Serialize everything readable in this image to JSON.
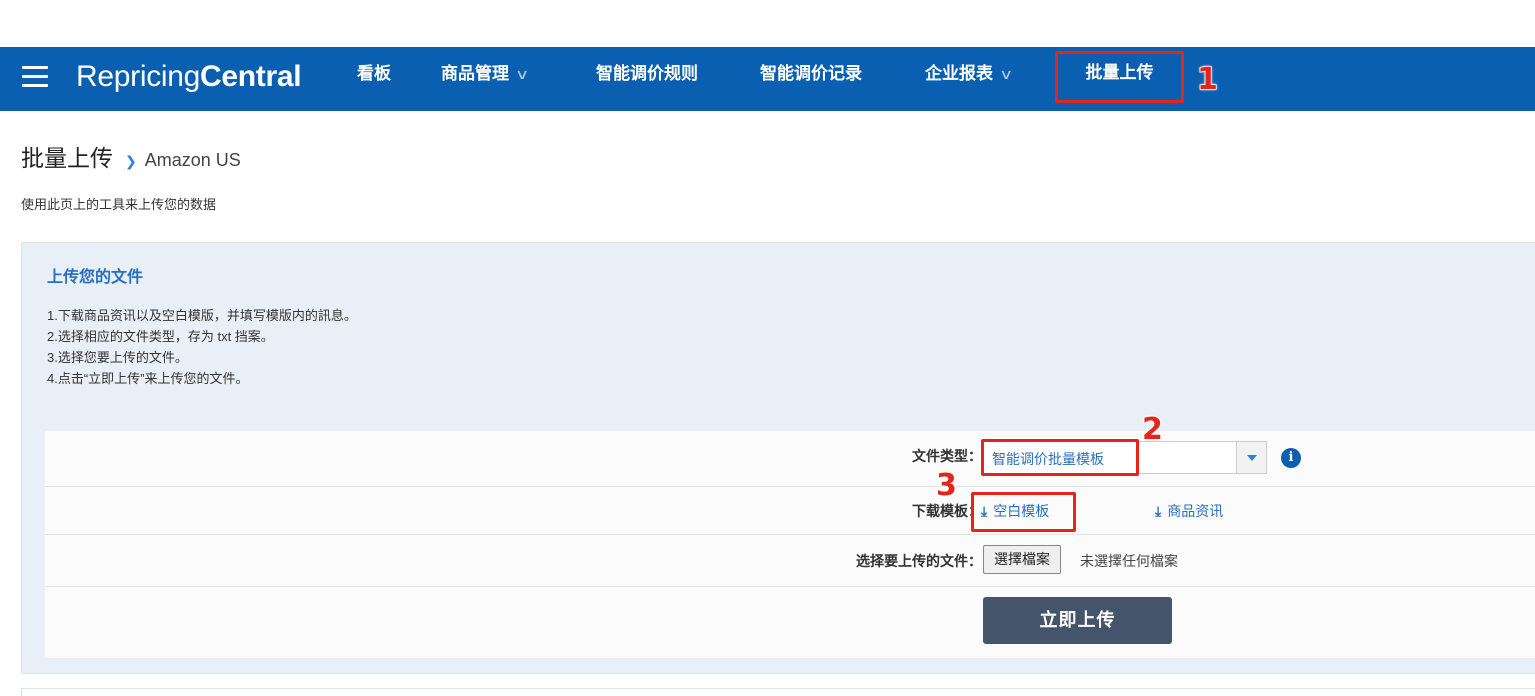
{
  "navbar": {
    "logo_part1": "Repricing",
    "logo_part2": "Central",
    "items": [
      {
        "label": "看板"
      },
      {
        "label": "商品管理",
        "chevron": "chevron-down-icon"
      },
      {
        "label": "智能调价规则"
      },
      {
        "label": "智能调价记录"
      },
      {
        "label": "企业报表",
        "chevron": "chevron-down-icon"
      },
      {
        "label": "批量上传"
      }
    ],
    "chevron_glyph": "∨",
    "color": "#0b5fb0"
  },
  "annotations": {
    "marker1": "1",
    "marker2": "2",
    "marker3": "3",
    "color": "#e5251b"
  },
  "breadcrumb": {
    "title": "批量上传",
    "separator": "❯",
    "sub": "Amazon US"
  },
  "subtitle": "使用此页上的工具来上传您的数据",
  "upload_panel": {
    "title": "上传您的文件",
    "steps": [
      "1.下载商品资讯以及空白模版，并填写模版内的訊息。",
      "2.选择相应的文件类型，存为 txt 挡案。",
      "3.选择您要上传的文件。",
      "4.点击“立即上传”来上传您的文件。"
    ],
    "file_type_label": "文件类型：",
    "file_type_value": "智能调价批量模板",
    "info_glyph": "i",
    "download_label": "下载模板：",
    "download_blank": "空白模板",
    "download_product": "商品资讯",
    "download_glyph": "⤓",
    "choose_file_label": "选择要上传的文件：",
    "choose_file_button": "選擇檔案",
    "no_file_text": "未選擇任何檔案",
    "upload_button": "立即上传"
  }
}
